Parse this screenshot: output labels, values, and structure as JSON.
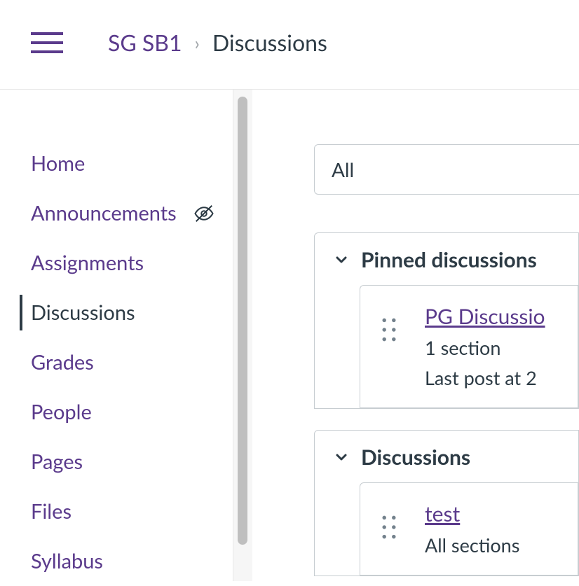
{
  "breadcrumb": {
    "course": "SG SB1",
    "page": "Discussions"
  },
  "sidebar": {
    "items": [
      {
        "label": "Home",
        "active": false,
        "hidden": false
      },
      {
        "label": "Announcements",
        "active": false,
        "hidden": true
      },
      {
        "label": "Assignments",
        "active": false,
        "hidden": false
      },
      {
        "label": "Discussions",
        "active": true,
        "hidden": false
      },
      {
        "label": "Grades",
        "active": false,
        "hidden": false
      },
      {
        "label": "People",
        "active": false,
        "hidden": false
      },
      {
        "label": "Pages",
        "active": false,
        "hidden": false
      },
      {
        "label": "Files",
        "active": false,
        "hidden": false
      },
      {
        "label": "Syllabus",
        "active": false,
        "hidden": false
      }
    ]
  },
  "filter": {
    "selected": "All"
  },
  "sections": [
    {
      "title": "Pinned discussions",
      "items": [
        {
          "title": "PG Discussio",
          "sectionText": "1 section",
          "lastPost": "Last post at 2"
        }
      ]
    },
    {
      "title": "Discussions",
      "items": [
        {
          "title": "test",
          "sectionText": "All sections",
          "lastPost": ""
        }
      ]
    }
  ]
}
